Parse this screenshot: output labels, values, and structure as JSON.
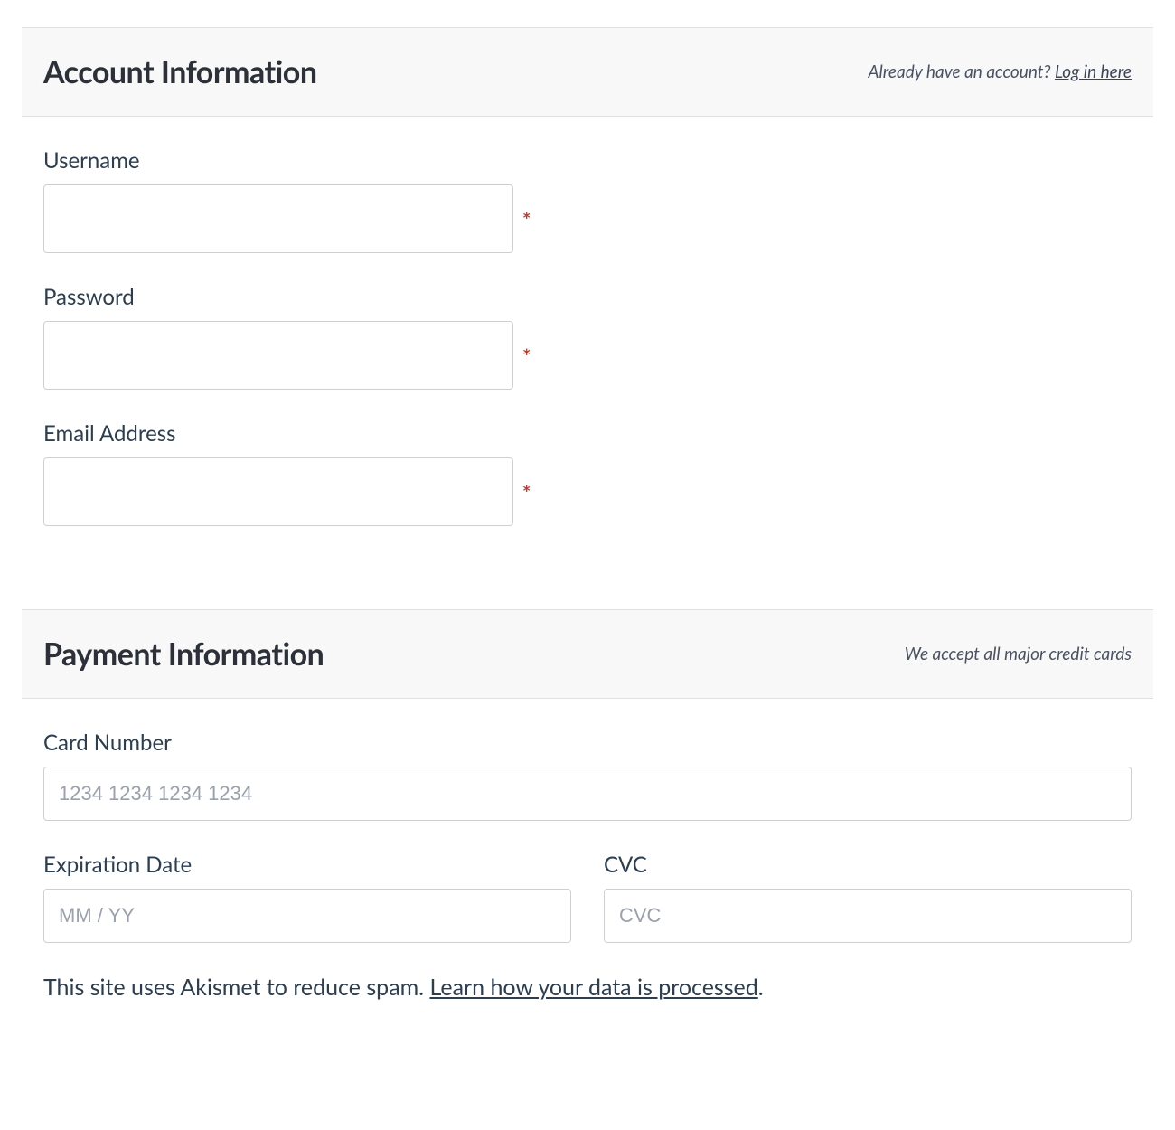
{
  "account": {
    "heading": "Account Information",
    "login_prompt": "Already have an account? ",
    "login_link": "Log in here",
    "fields": {
      "username": {
        "label": "Username",
        "value": "",
        "placeholder": "",
        "required": "*"
      },
      "password": {
        "label": "Password",
        "value": "",
        "placeholder": "",
        "required": "*"
      },
      "email": {
        "label": "Email Address",
        "value": "",
        "placeholder": "",
        "required": "*"
      }
    }
  },
  "payment": {
    "heading": "Payment Information",
    "side_note": "We accept all major credit cards",
    "fields": {
      "card_number": {
        "label": "Card Number",
        "value": "",
        "placeholder": "1234 1234 1234 1234"
      },
      "expiration": {
        "label": "Expiration Date",
        "value": "",
        "placeholder": "MM / YY"
      },
      "cvc": {
        "label": "CVC",
        "value": "",
        "placeholder": "CVC"
      }
    }
  },
  "spam": {
    "text": "This site uses Akismet to reduce spam. ",
    "link": "Learn how your data is processed",
    "suffix": "."
  }
}
